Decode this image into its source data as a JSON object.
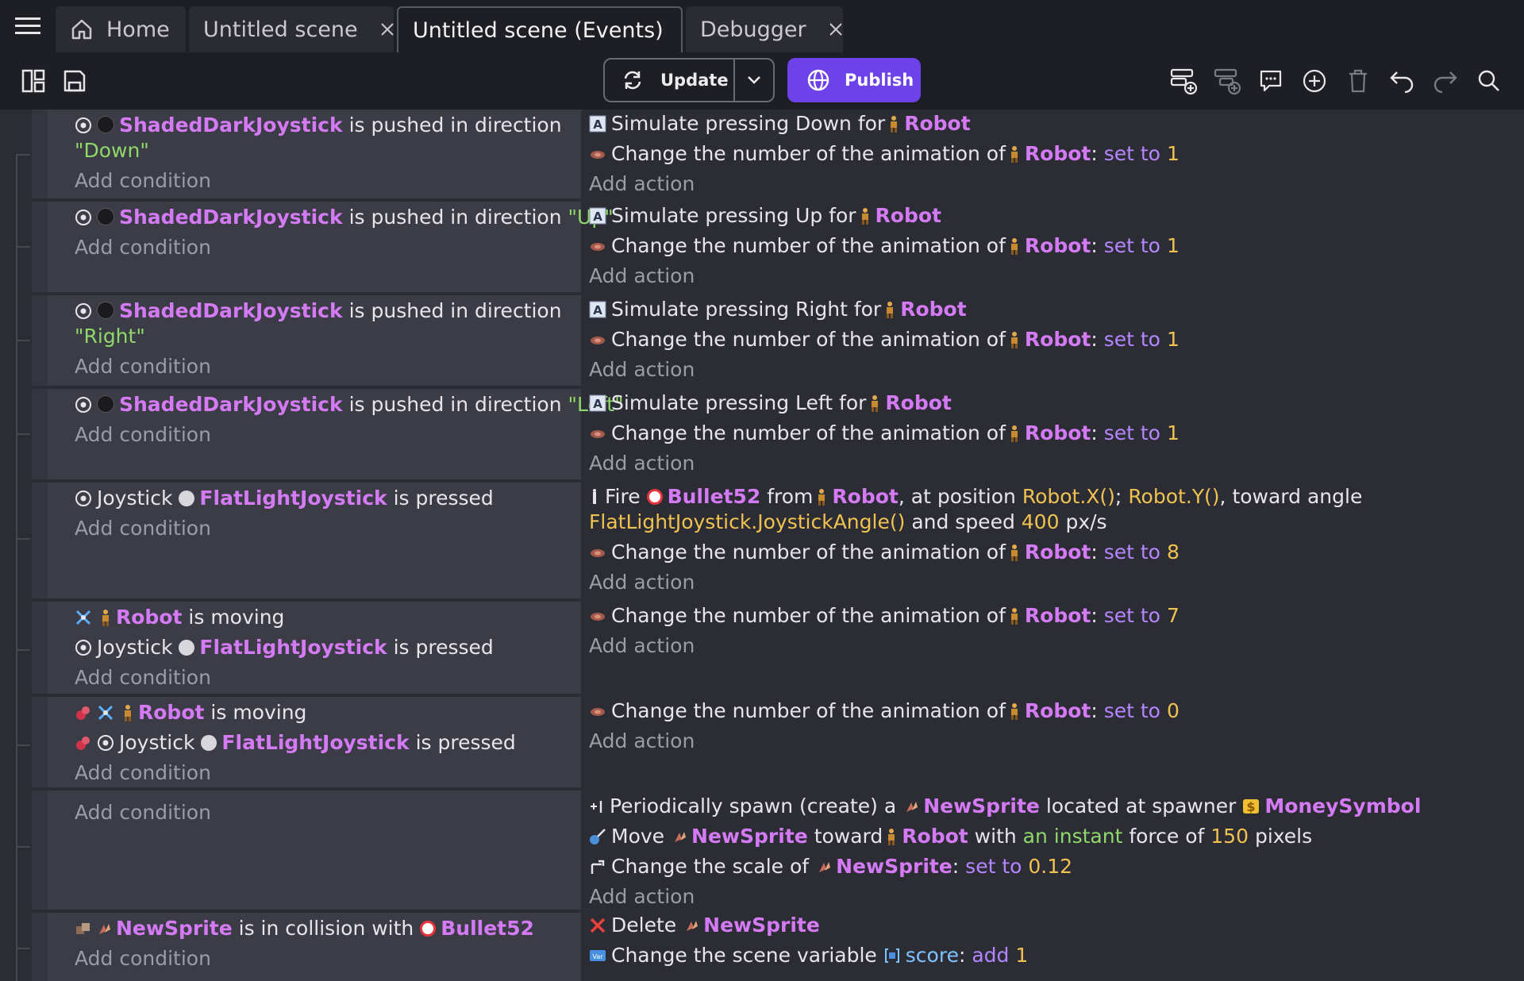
{
  "tabs": {
    "home": "Home",
    "scene": "Untitled scene",
    "events": "Untitled scene (Events)",
    "debugger": "Debugger"
  },
  "toolbar": {
    "update_label": "Update",
    "publish_label": "Publish"
  },
  "colors": {
    "object": "#d57af5",
    "string": "#8fd86a",
    "operator": "#b486ff",
    "number": "#f0c250",
    "variable": "#7fc3ff",
    "publish": "#6d42e8"
  },
  "common": {
    "add_condition": "Add condition",
    "add_action": "Add action",
    "robot": "Robot",
    "shaded": "ShadedDarkJoystick",
    "flat": "FlatLightJoystick",
    "pushed_in_dir": "is pushed in direction",
    "change_anim": "Change the number of the animation of",
    "set_to": "set to",
    "joystick": "Joystick",
    "is_pressed": "is pressed",
    "is_moving": "is moving",
    "newsprite": "NewSprite",
    "bullet": "Bullet52"
  },
  "events": [
    {
      "dir": "\"Down\"",
      "sim": "Simulate pressing Down for",
      "anim": "1"
    },
    {
      "dir": "\"Up\"",
      "sim": "Simulate pressing Up for",
      "anim": "1"
    },
    {
      "dir": "\"Right\"",
      "sim": "Simulate pressing Right for",
      "anim": "1"
    },
    {
      "dir": "\"Left\"",
      "sim": "Simulate pressing Left for",
      "anim": "1"
    }
  ],
  "fire_event": {
    "fire": "Fire",
    "from": "from",
    "at_position": ", at position",
    "pos_x": "Robot.X()",
    "semi": ";",
    "pos_y": "Robot.Y()",
    "toward_angle": ", toward angle",
    "angle": "FlatLightJoystick.JoystickAngle()",
    "and_speed": "and speed",
    "speed": "400",
    "unit": "px/s",
    "anim": "8"
  },
  "moving_event": {
    "anim": "7"
  },
  "not_moving_event": {
    "anim": "0"
  },
  "spawn_event": {
    "periodic": "Periodically spawn (create) a",
    "located": "located at spawner",
    "spawner": "MoneySymbol",
    "move": "Move",
    "toward": "toward",
    "with": "with",
    "instant": "an instant",
    "force_of": "force of",
    "force": "150",
    "pixels": "pixels",
    "scale": "Change the scale of",
    "scale_val": "0.12"
  },
  "collision_event": {
    "collides": "is in collision with",
    "delete": "Delete",
    "scene_var": "Change the scene variable",
    "var_name": "score",
    "add": "add",
    "add_val": "1"
  }
}
